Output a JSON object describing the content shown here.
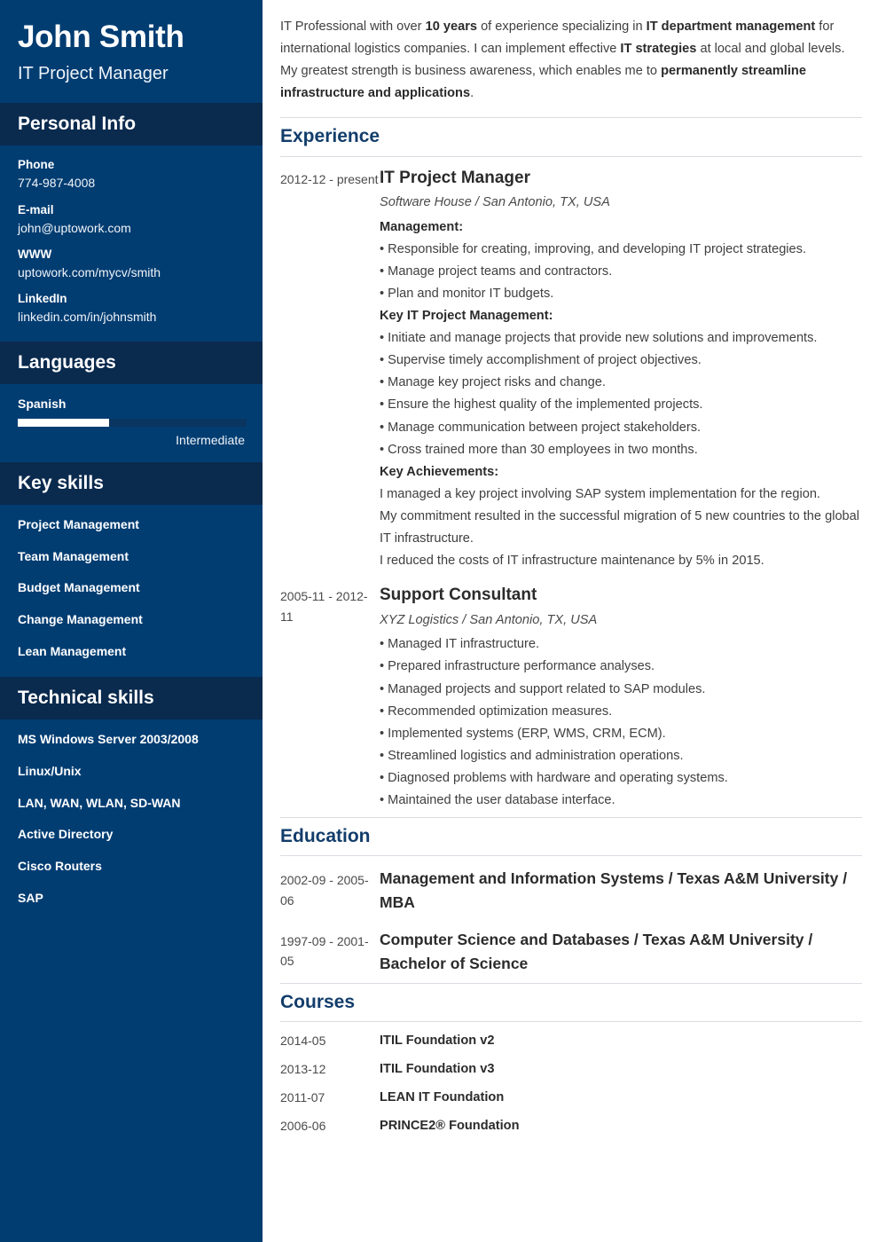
{
  "colors": {
    "sidebar_bg": "#023d72",
    "sidebar_header_bg": "#0a2a4e",
    "accent_heading": "#123d6b",
    "rule": "#d9dde1",
    "bar_track": "#0a3560",
    "bar_fill": "#ffffff"
  },
  "sidebar": {
    "full_name": "John Smith",
    "job_title": "IT Project Manager",
    "personal_info": {
      "heading": "Personal Info",
      "items": [
        {
          "label": "Phone",
          "value": "774-987-4008"
        },
        {
          "label": "E-mail",
          "value": "john@uptowork.com"
        },
        {
          "label": "WWW",
          "value": "uptowork.com/mycv/smith"
        },
        {
          "label": "LinkedIn",
          "value": "linkedin.com/in/johnsmith"
        }
      ]
    },
    "languages": {
      "heading": "Languages",
      "items": [
        {
          "name": "Spanish",
          "level_label": "Intermediate",
          "level_percent": 40
        }
      ]
    },
    "key_skills": {
      "heading": "Key skills",
      "items": [
        "Project Management",
        "Team Management",
        "Budget Management",
        "Change Management",
        "Lean Management"
      ]
    },
    "technical_skills": {
      "heading": "Technical skills",
      "items": [
        "MS Windows Server 2003/2008",
        "Linux/Unix",
        "LAN, WAN, WLAN, SD-WAN",
        "Active Directory",
        "Cisco Routers",
        "SAP"
      ]
    }
  },
  "main": {
    "summary_html": "IT Professional with over <b>10 years</b> of experience specializing in <b>IT department management</b> for international logistics companies. I can implement effective <b>IT strategies</b> at local and global levels. My greatest strength is business awareness, which enables me to <b>permanently streamline infrastructure and applications</b>.",
    "experience": {
      "heading": "Experience",
      "entries": [
        {
          "date": "2012-12 - present",
          "role": "IT Project Manager",
          "company": "Software House / San Antonio, TX, USA",
          "lines": [
            {
              "type": "subhead",
              "text": "Management:"
            },
            {
              "type": "bullet",
              "text": "• Responsible for creating, improving, and developing IT project strategies."
            },
            {
              "type": "bullet",
              "text": "• Manage project teams and contractors."
            },
            {
              "type": "bullet",
              "text": "• Plan and monitor IT budgets."
            },
            {
              "type": "subhead",
              "text": "Key IT Project Management:"
            },
            {
              "type": "bullet",
              "text": "• Initiate and manage projects that provide new solutions and improvements."
            },
            {
              "type": "bullet",
              "text": "• Supervise timely accomplishment of project objectives."
            },
            {
              "type": "bullet",
              "text": "• Manage key project risks and change."
            },
            {
              "type": "bullet",
              "text": "• Ensure the highest quality of the implemented projects."
            },
            {
              "type": "bullet",
              "text": "• Manage communication between project stakeholders."
            },
            {
              "type": "bullet",
              "text": "• Cross trained more than 30 employees in two months."
            },
            {
              "type": "subhead",
              "text": "Key Achievements:"
            },
            {
              "type": "text",
              "text": "I managed a key project involving SAP system implementation for the region."
            },
            {
              "type": "text",
              "text": "My commitment resulted in the successful migration of 5 new countries to the global IT infrastructure."
            },
            {
              "type": "text",
              "text": "I reduced the costs of IT infrastructure maintenance by 5% in 2015."
            }
          ]
        },
        {
          "date": "2005-11 - 2012-11",
          "role": "Support Consultant",
          "company": "XYZ Logistics / San Antonio, TX, USA",
          "lines": [
            {
              "type": "bullet",
              "text": "• Managed IT infrastructure."
            },
            {
              "type": "bullet",
              "text": "• Prepared infrastructure performance analyses."
            },
            {
              "type": "bullet",
              "text": "• Managed projects and support related to SAP modules."
            },
            {
              "type": "bullet",
              "text": "• Recommended optimization measures."
            },
            {
              "type": "bullet",
              "text": "• Implemented systems (ERP, WMS, CRM, ECM)."
            },
            {
              "type": "bullet",
              "text": "• Streamlined logistics and administration operations."
            },
            {
              "type": "bullet",
              "text": "• Diagnosed problems with hardware and operating systems."
            },
            {
              "type": "bullet",
              "text": "• Maintained the user database interface."
            }
          ]
        }
      ]
    },
    "education": {
      "heading": "Education",
      "entries": [
        {
          "date": "2002-09 - 2005-06",
          "title": "Management and Information Systems / Texas A&M University / MBA"
        },
        {
          "date": "1997-09 - 2001-05",
          "title": "Computer Science and Databases / Texas A&M University / Bachelor of Science"
        }
      ]
    },
    "courses": {
      "heading": "Courses",
      "entries": [
        {
          "date": "2014-05",
          "name": "ITIL Foundation v2"
        },
        {
          "date": "2013-12",
          "name": "ITIL Foundation v3"
        },
        {
          "date": "2011-07",
          "name": "LEAN IT Foundation"
        },
        {
          "date": "2006-06",
          "name": "PRINCE2® Foundation"
        }
      ]
    }
  }
}
